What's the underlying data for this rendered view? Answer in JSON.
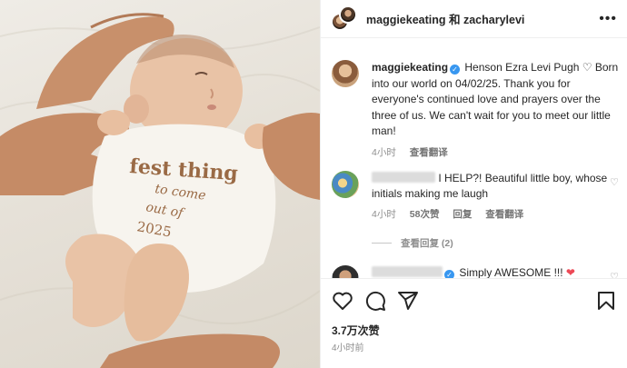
{
  "header": {
    "names": "maggiekeating 和 zacharylevi",
    "more_icon": "more-horizontal-icon"
  },
  "caption": {
    "username": "maggiekeating",
    "text": "Henson Ezra Levi Pugh ♡ Born into our world on 04/02/25. Thank you for everyone's continued love and prayers over the three of us. We can't wait for you to meet our little man!",
    "time": "4小时",
    "translate": "查看翻译"
  },
  "comment1": {
    "text": "I HELP?! Beautiful little boy, whose initials making me laugh",
    "time": "4小时",
    "likes": "58次赞",
    "reply": "回复",
    "translate": "查看翻译"
  },
  "replies_toggle": "查看回复 (2)",
  "comment2": {
    "text": "Simply AWESOME !!! ❤"
  },
  "actions": {
    "like_icon": "heart-icon",
    "comment_icon": "comment-icon",
    "share_icon": "share-icon",
    "save_icon": "bookmark-icon",
    "likes": "3.7万次赞",
    "time": "4小时前"
  },
  "photo": {
    "onesie_text": [
      "fest thing",
      "to come",
      "out of",
      "2025"
    ]
  },
  "colors": {
    "verified": "#3897f0",
    "muted": "#8e8e8e",
    "red_heart": "#ed4956"
  }
}
